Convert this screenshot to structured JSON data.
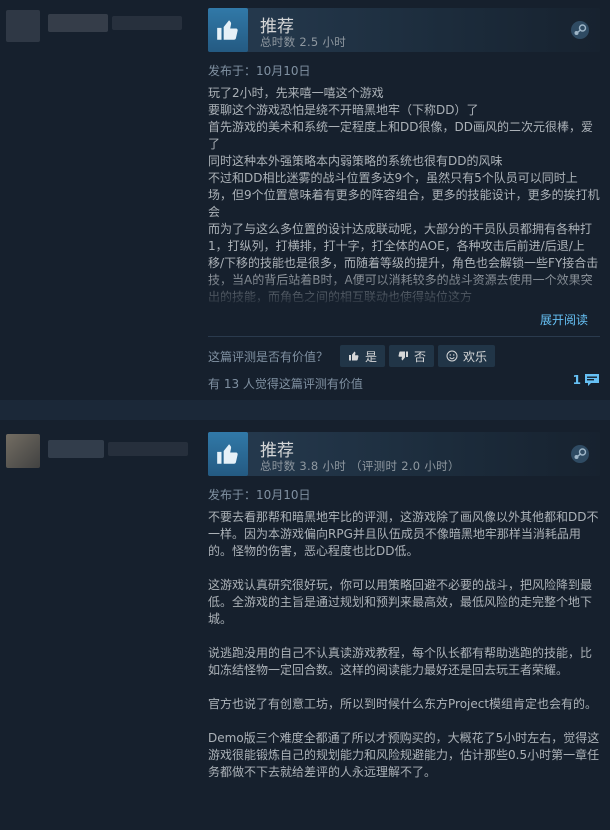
{
  "colors": {
    "page_bg": "#1b2838",
    "card_bg": "#16202d",
    "link": "#66c0f4",
    "thumb_box": "#2f76a6"
  },
  "reviews": [
    {
      "vote": "推荐",
      "hours": "总时数 2.5 小时",
      "posted": "发布于：10月10日",
      "text": "玩了2小时，先来嘻一嘻这个游戏\n要聊这个游戏恐怕是绕不开暗黑地牢（下称DD）了\n首先游戏的美术和系统一定程度上和DD很像，DD画风的二次元很棒，爱了\n同时这种本外强策略本内弱策略的系统也很有DD的风味\n不过和DD相比迷雾的战斗位置多达9个，虽然只有5个队员可以同时上场，但9个位置意味着有更多的阵容组合，更多的技能设计，更多的挨打机会\n而为了与这么多位置的设计达成联动呢，大部分的干员队员都拥有各种打1，打纵列，打横排，打十字，打全体的AOE，各种攻击后前进/后退/上移/下移的技能也是很多，而随着等级的提升，角色也会解锁一些FY接合击技，当A的背后站着B时，A便可以消耗较多的战斗资源去使用一个效果突出的技能，而角色之间的相互联动也使得站位这方",
      "expand": "展开阅读",
      "helpful_question": "这篇评测是否有价值？",
      "btn_yes": "是",
      "btn_no": "否",
      "btn_funny": "欢乐",
      "helpful_count": "有 13 人觉得这篇评测有价值",
      "comments": "1"
    },
    {
      "vote": "推荐",
      "hours": "总时数 3.8 小时 （评测时 2.0 小时）",
      "posted": "发布于：10月10日",
      "text": "不要去看那帮和暗黑地牢比的评测，这游戏除了画风像以外其他都和DD不一样。因为本游戏偏向RPG并且队伍成员不像暗黑地牢那样当消耗品用的。怪物的伤害，恶心程度也比DD低。\n\n这游戏认真研究很好玩，你可以用策略回避不必要的战斗，把风险降到最低。全游戏的主旨是通过规划和预判来最高效，最低风险的走完整个地下城。\n\n说逃跑没用的自己不认真读游戏教程，每个队长都有帮助逃跑的技能，比如冻结怪物一定回合数。这样的阅读能力最好还是回去玩王者荣耀。\n\n官方也说了有创意工坊，所以到时候什么东方Project模组肯定也会有的。\n\nDemo版三个难度全都通了所以才预购买的，大概花了5小时左右，觉得这游戏很能锻炼自己的规划能力和风险规避能力，估计那些0.5小时第一章任务都做不下去就给差评的人永远理解不了。"
    }
  ]
}
